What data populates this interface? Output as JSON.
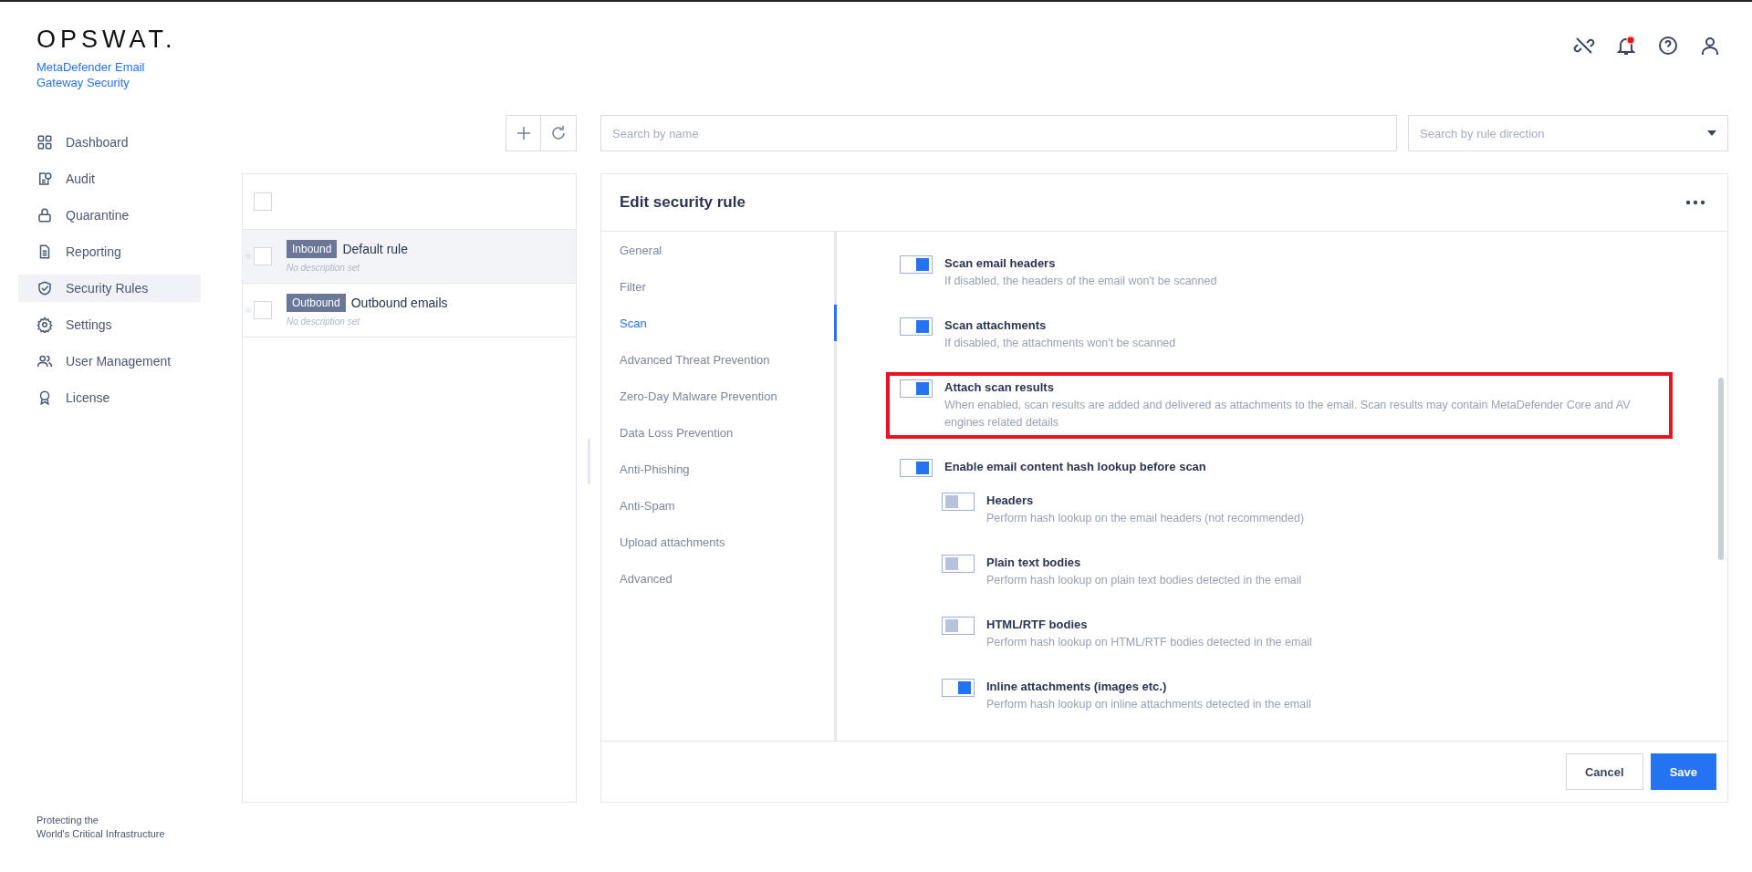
{
  "brand": {
    "logo": "OPSWAT.",
    "product": "MetaDefender Email Gateway Security",
    "tagline": "Protecting the\nWorld's Critical Infrastructure"
  },
  "nav": [
    {
      "label": "Dashboard",
      "selected": false
    },
    {
      "label": "Audit",
      "selected": false
    },
    {
      "label": "Quarantine",
      "selected": false
    },
    {
      "label": "Reporting",
      "selected": false
    },
    {
      "label": "Security Rules",
      "selected": true
    },
    {
      "label": "Settings",
      "selected": false
    },
    {
      "label": "User Management",
      "selected": false
    },
    {
      "label": "License",
      "selected": false
    }
  ],
  "header": {
    "notifications_unread": true
  },
  "search": {
    "placeholder": "Search by name"
  },
  "direction_filter": {
    "placeholder": "Search by rule direction"
  },
  "rules": [
    {
      "direction": "Inbound",
      "name": "Default rule",
      "description": "No description set",
      "selected": true,
      "checked": false
    },
    {
      "direction": "Outbound",
      "name": "Outbound emails",
      "description": "No description set",
      "selected": false,
      "checked": false
    }
  ],
  "select_all": {
    "checked": false
  },
  "editor": {
    "title": "Edit security rule",
    "sections": [
      {
        "label": "General",
        "selected": false
      },
      {
        "label": "Filter",
        "selected": false
      },
      {
        "label": "Scan",
        "selected": true
      },
      {
        "label": "Advanced Threat Prevention",
        "selected": false
      },
      {
        "label": "Zero-Day Malware Prevention",
        "selected": false
      },
      {
        "label": "Data Loss Prevention",
        "selected": false
      },
      {
        "label": "Anti-Phishing",
        "selected": false
      },
      {
        "label": "Anti-Spam",
        "selected": false
      },
      {
        "label": "Upload attachments",
        "selected": false
      },
      {
        "label": "Advanced",
        "selected": false
      }
    ],
    "settings": [
      {
        "title": "Scan email headers",
        "description": "If disabled, the headers of the email won't be scanned",
        "on": true
      },
      {
        "title": "Scan attachments",
        "description": "If disabled, the attachments won't be scanned",
        "on": true
      },
      {
        "title": "Attach scan results",
        "description": "When enabled, scan results are added and delivered as attachments to the email. Scan results may contain MetaDefender Core and AV engines related details",
        "on": true,
        "highlighted": true
      },
      {
        "title": "Enable email content hash lookup before scan",
        "on": true,
        "children": [
          {
            "title": "Headers",
            "description": "Perform hash lookup on the email headers (not recommended)",
            "on": false
          },
          {
            "title": "Plain text bodies",
            "description": "Perform hash lookup on plain text bodies detected in the email",
            "on": false
          },
          {
            "title": "HTML/RTF bodies",
            "description": "Perform hash lookup on HTML/RTF bodies detected in the email",
            "on": false
          },
          {
            "title": "Inline attachments (images etc.)",
            "description": "Perform hash lookup on inline attachments detected in the email",
            "on": true
          }
        ]
      }
    ],
    "buttons": [
      {
        "label": "Cancel",
        "kind": "secondary"
      },
      {
        "label": "Save",
        "kind": "primary"
      }
    ]
  }
}
